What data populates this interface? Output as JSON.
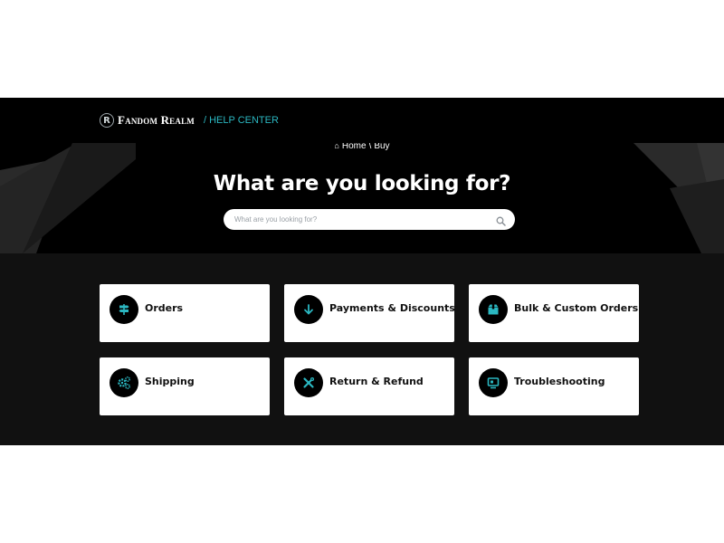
{
  "header": {
    "logo_letter": "R",
    "brand": "Fandom Realm",
    "section": "/ HELP CENTER"
  },
  "breadcrumb": {
    "home": "Home",
    "separator": "\\",
    "current": "Buy"
  },
  "hero": {
    "title": "What are you looking for?"
  },
  "search": {
    "placeholder": "What are you looking for?"
  },
  "categories": [
    {
      "label": "Orders",
      "icon": "signpost-icon"
    },
    {
      "label": "Payments & Discounts",
      "icon": "arrow-down-icon"
    },
    {
      "label": "Bulk & Custom Orders",
      "icon": "box-icon"
    },
    {
      "label": "Shipping",
      "icon": "gears-icon"
    },
    {
      "label": "Return & Refund",
      "icon": "tools-icon"
    },
    {
      "label": "Troubleshooting",
      "icon": "monitor-icon"
    }
  ],
  "colors": {
    "accent": "#2bb7c1",
    "header_bg": "#000000",
    "section_bg": "#111111",
    "card_bg": "#ffffff"
  }
}
